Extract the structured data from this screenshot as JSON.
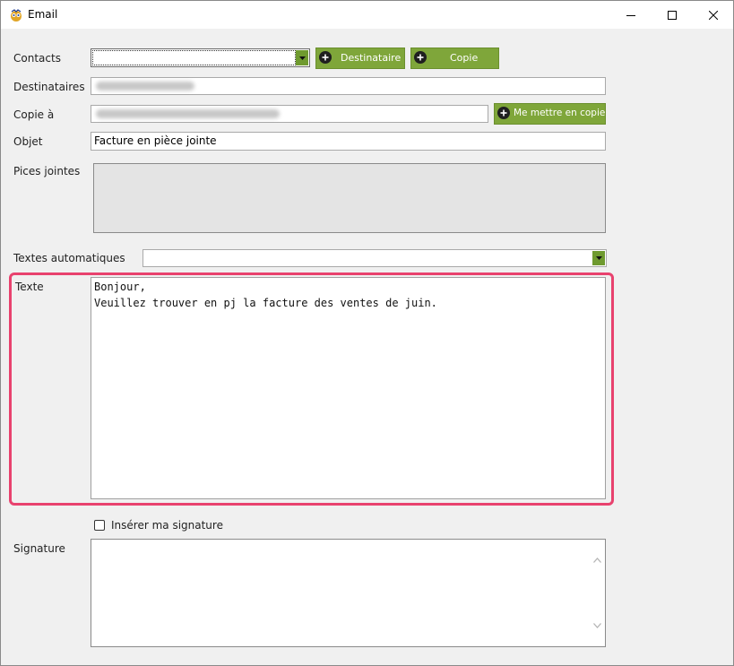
{
  "window": {
    "title": "Email"
  },
  "form": {
    "contacts": {
      "label": "Contacts",
      "value": ""
    },
    "buttons": {
      "recipient": "Destinataire",
      "copy": "Copie",
      "cc_me": "Me mettre en copie"
    },
    "recipients": {
      "label": "Destinataires"
    },
    "copy_to": {
      "label": "Copie à"
    },
    "subject": {
      "label": "Objet",
      "value": "Facture en pièce jointe"
    },
    "attachments": {
      "label": "Pices jointes"
    },
    "auto_texts": {
      "label": "Textes automatiques",
      "value": ""
    },
    "body": {
      "label": "Texte",
      "lines": [
        "Bonjour,",
        "Veuillez trouver en pj la facture des ventes de juin."
      ]
    },
    "signature_checkbox": {
      "label": "Insérer ma signature",
      "checked": false
    },
    "signature": {
      "label": "Signature",
      "value": ""
    }
  },
  "colors": {
    "button_green": "#7fa63a",
    "highlight": "#e8426e"
  }
}
